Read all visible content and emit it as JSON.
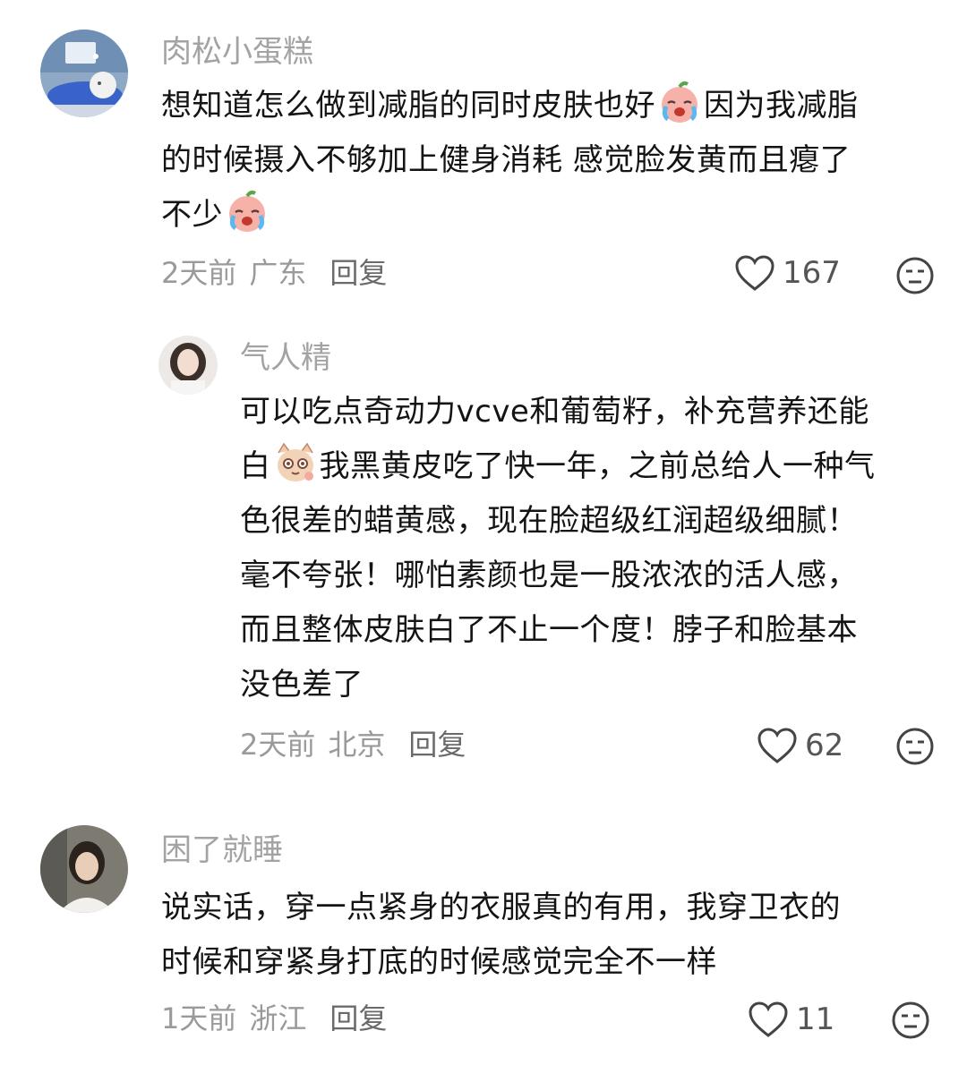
{
  "comments": [
    {
      "username": "肉松小蛋糕",
      "lines": [
        "想知道怎么做到减脂的同时皮肤也好",
        "因为我减脂",
        "的时候摄入不够加上健身消耗 感觉脸发黄而且瘪了",
        "不少"
      ],
      "time": "2天前",
      "location": "广东",
      "reply": "回复",
      "likes": "167",
      "like_icon": "heart-outline-icon",
      "face_icon": "neutral-face-icon"
    },
    {
      "username": "气人精",
      "lines": [
        "可以吃点奇动力vcve和葡萄籽，补充营养还能",
        "白",
        "我黑黄皮吃了快一年，之前总给人一种气",
        "色很差的蜡黄感，现在脸超级红润超级细腻！",
        "毫不夸张！哪怕素颜也是一股浓浓的活人感，",
        "而且整体皮肤白了不止一个度！脖子和脸基本",
        "没色差了"
      ],
      "time": "2天前",
      "location": "北京",
      "reply": "回复",
      "likes": "62",
      "like_icon": "heart-outline-icon",
      "face_icon": "neutral-face-icon"
    },
    {
      "username": "困了就睡",
      "lines": [
        "说实话，穿一点紧身的衣服真的有用，我穿卫衣的",
        "时候和穿紧身打底的时候感觉完全不一样"
      ],
      "time": "1天前",
      "location": "浙江",
      "reply": "回复",
      "likes": "11",
      "like_icon": "heart-outline-icon",
      "face_icon": "neutral-face-icon"
    }
  ],
  "colors": {
    "username": "#a3a3a3",
    "text": "#141414",
    "meta": "#9a9a9a",
    "reply": "#6a6a6a"
  }
}
